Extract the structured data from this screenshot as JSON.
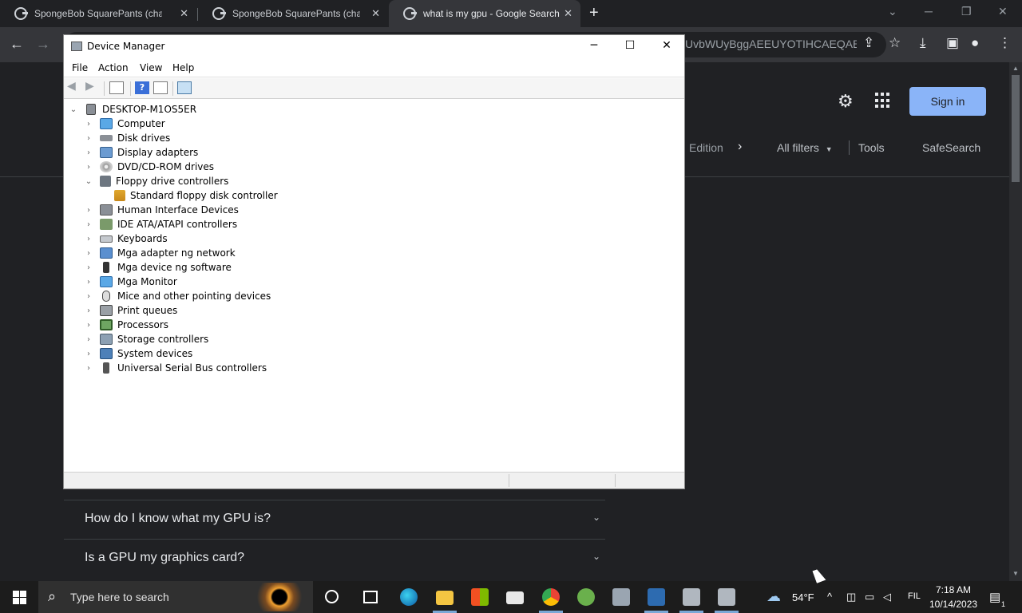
{
  "browser": {
    "tabs": [
      {
        "title": "SpongeBob SquarePants (characte",
        "active": false
      },
      {
        "title": "SpongeBob SquarePants (characte",
        "active": false
      },
      {
        "title": "what is my gpu - Google Search",
        "active": true
      }
    ],
    "new_tab": "+",
    "tab_close": "✕",
    "address_fragment": "UvbWUyBggAEEUYOTIHCAEQAB...",
    "icons": {
      "back": "arrow-left-icon",
      "forward": "arrow-right-icon",
      "share": "share-icon",
      "bookmark": "star-icon",
      "download": "download-icon",
      "side_panel": "side-panel-icon",
      "profile": "profile-icon",
      "menu": "kebab-menu-icon"
    }
  },
  "google": {
    "sign_in": "Sign in",
    "filters": {
      "partial_chip": "Edition",
      "all_filters": "All filters",
      "tools": "Tools",
      "safesearch": "SafeSearch"
    },
    "faq": [
      {
        "question": "How do I know what my GPU is?"
      },
      {
        "question": "Is a GPU my graphics card?"
      }
    ],
    "accent_color": "#8ab4f8"
  },
  "device_manager": {
    "title": "Device Manager",
    "menu": [
      "File",
      "Action",
      "View",
      "Help"
    ],
    "window_controls": {
      "minimize": "─",
      "maximize": "☐",
      "close": "✕"
    },
    "root": "DESKTOP-M1OS5ER",
    "categories": [
      {
        "label": "Computer",
        "icon": "computer-monitor-icon",
        "expanded": false
      },
      {
        "label": "Disk drives",
        "icon": "disk-drive-icon",
        "expanded": false
      },
      {
        "label": "Display adapters",
        "icon": "display-adapter-icon",
        "expanded": false
      },
      {
        "label": "DVD/CD-ROM drives",
        "icon": "dvd-icon",
        "expanded": false
      },
      {
        "label": "Floppy drive controllers",
        "icon": "floppy-controller-icon",
        "expanded": true,
        "children": [
          {
            "label": "Standard floppy disk controller",
            "icon": "warning-device-icon"
          }
        ]
      },
      {
        "label": "Human Interface Devices",
        "icon": "hid-icon",
        "expanded": false
      },
      {
        "label": "IDE ATA/ATAPI controllers",
        "icon": "ide-controller-icon",
        "expanded": false
      },
      {
        "label": "Keyboards",
        "icon": "keyboard-icon",
        "expanded": false
      },
      {
        "label": "Mga adapter ng network",
        "icon": "network-adapter-icon",
        "expanded": false
      },
      {
        "label": "Mga device ng software",
        "icon": "software-device-icon",
        "expanded": false
      },
      {
        "label": "Mga Monitor",
        "icon": "monitor-icon",
        "expanded": false
      },
      {
        "label": "Mice and other pointing devices",
        "icon": "mouse-icon",
        "expanded": false
      },
      {
        "label": "Print queues",
        "icon": "printer-icon",
        "expanded": false
      },
      {
        "label": "Processors",
        "icon": "processor-icon",
        "expanded": false
      },
      {
        "label": "Storage controllers",
        "icon": "storage-controller-icon",
        "expanded": false
      },
      {
        "label": "System devices",
        "icon": "system-devices-icon",
        "expanded": false
      },
      {
        "label": "Universal Serial Bus controllers",
        "icon": "usb-icon",
        "expanded": false
      }
    ]
  },
  "taskbar": {
    "search_placeholder": "Type here to search",
    "weather": "54°F",
    "language": "FIL",
    "time": "7:18 AM",
    "date": "10/14/2023",
    "notification_count": "1",
    "pinned_apps": [
      "cortana",
      "task-view",
      "edge",
      "file-explorer",
      "microsoft-store",
      "mail",
      "chrome",
      "utorrent",
      "app-1",
      "app-2",
      "app-3",
      "app-4"
    ]
  }
}
